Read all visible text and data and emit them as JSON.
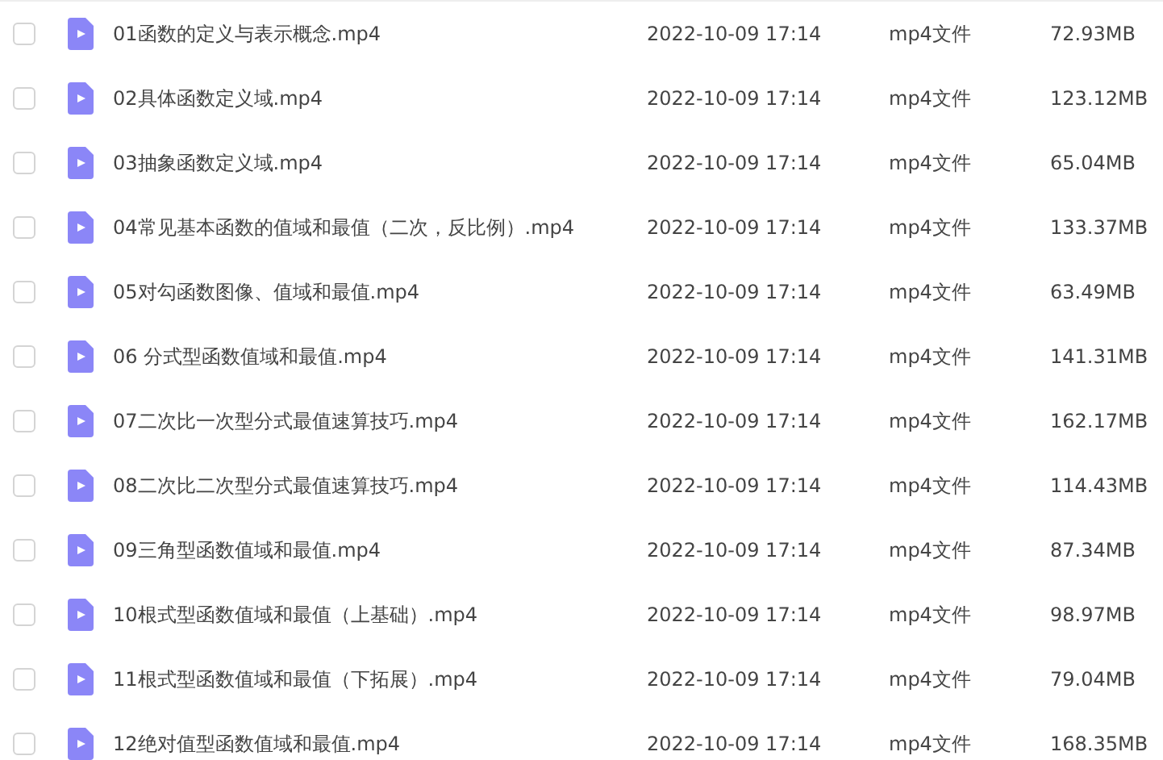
{
  "files": [
    {
      "checked": false,
      "name": "01函数的定义与表示概念.mp4",
      "modified": "2022-10-09 17:14",
      "type": "mp4文件",
      "size": "72.93MB"
    },
    {
      "checked": false,
      "name": "02具体函数定义域.mp4",
      "modified": "2022-10-09 17:14",
      "type": "mp4文件",
      "size": "123.12MB"
    },
    {
      "checked": false,
      "name": "03抽象函数定义域.mp4",
      "modified": "2022-10-09 17:14",
      "type": "mp4文件",
      "size": "65.04MB"
    },
    {
      "checked": false,
      "name": "04常见基本函数的值域和最值（二次，反比例）.mp4",
      "modified": "2022-10-09 17:14",
      "type": "mp4文件",
      "size": "133.37MB"
    },
    {
      "checked": false,
      "name": "05对勾函数图像、值域和最值.mp4",
      "modified": "2022-10-09 17:14",
      "type": "mp4文件",
      "size": "63.49MB"
    },
    {
      "checked": false,
      "name": "06 分式型函数值域和最值.mp4",
      "modified": "2022-10-09 17:14",
      "type": "mp4文件",
      "size": "141.31MB"
    },
    {
      "checked": false,
      "name": "07二次比一次型分式最值速算技巧.mp4",
      "modified": "2022-10-09 17:14",
      "type": "mp4文件",
      "size": "162.17MB"
    },
    {
      "checked": false,
      "name": "08二次比二次型分式最值速算技巧.mp4",
      "modified": "2022-10-09 17:14",
      "type": "mp4文件",
      "size": "114.43MB"
    },
    {
      "checked": false,
      "name": "09三角型函数值域和最值.mp4",
      "modified": "2022-10-09 17:14",
      "type": "mp4文件",
      "size": "87.34MB"
    },
    {
      "checked": false,
      "name": "10根式型函数值域和最值（上基础）.mp4",
      "modified": "2022-10-09 17:14",
      "type": "mp4文件",
      "size": "98.97MB"
    },
    {
      "checked": false,
      "name": "11根式型函数值域和最值（下拓展）.mp4",
      "modified": "2022-10-09 17:14",
      "type": "mp4文件",
      "size": "79.04MB"
    },
    {
      "checked": false,
      "name": "12绝对值型函数值域和最值.mp4",
      "modified": "2022-10-09 17:14",
      "type": "mp4文件",
      "size": "168.35MB"
    }
  ]
}
